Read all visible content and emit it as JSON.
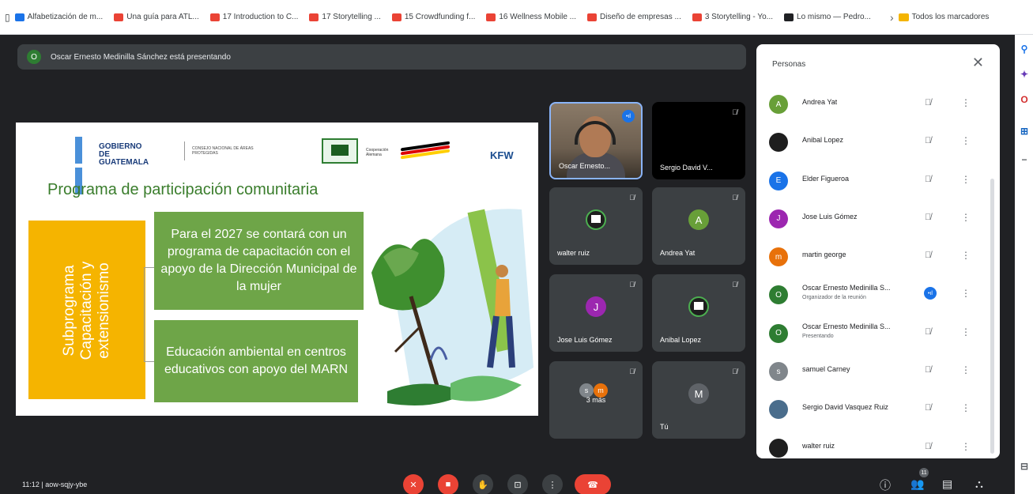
{
  "bookmarks": [
    {
      "label": "Alfabetización de m...",
      "color": "#1a73e8"
    },
    {
      "label": "Una guía para ATL...",
      "color": "#ea4335"
    },
    {
      "label": "17 Introduction to C...",
      "color": "#ea4335"
    },
    {
      "label": "17 Storytelling ...",
      "color": "#ea4335"
    },
    {
      "label": "15 Crowdfunding f...",
      "color": "#ea4335"
    },
    {
      "label": "16 Wellness Mobile ...",
      "color": "#ea4335"
    },
    {
      "label": "Diseño de empresas ...",
      "color": "#ea4335"
    },
    {
      "label": "3 Storytelling - Yo...",
      "color": "#ea4335"
    },
    {
      "label": "Lo mismo — Pedro...",
      "color": "#202124"
    }
  ],
  "bookmarks_more": "›",
  "bookmarks_folder": "Todos los marcadores",
  "presenter_banner": {
    "avatar": "O",
    "text": "Oscar Ernesto Medinilla Sánchez está presentando"
  },
  "slide": {
    "gov_name": "GOBIERNO DE GUATEMALA",
    "gov_sub": "CONSEJO NACIONAL DE ÁREAS PROTEGIDAS",
    "coop_label": "Cooperación Alemana",
    "kfw": "KFW",
    "title": "Programa de participación comunitaria",
    "vertical_text": "Subprograma\nCapacitación y\nextensionismo",
    "box1": "Para el 2027 se contará con un programa de capacitación con el apoyo de la Dirección Municipal de la mujer",
    "box2": "Educación ambiental en centros educativos con apoyo del MARN"
  },
  "tiles": [
    {
      "name": "Oscar Ernesto...",
      "kind": "video"
    },
    {
      "name": "Sergio David V...",
      "kind": "blank"
    },
    {
      "name": "walter ruiz",
      "kind": "qr"
    },
    {
      "name": "Andrea Yat",
      "kind": "avatar",
      "initial": "A",
      "color": "#689f38"
    },
    {
      "name": "Jose Luis Gómez",
      "kind": "avatar",
      "initial": "J",
      "color": "#9c27b0"
    },
    {
      "name": "Anibal Lopez",
      "kind": "qr"
    },
    {
      "name": "3 más",
      "kind": "more",
      "initials": [
        "s",
        "m"
      ]
    },
    {
      "name": "Tú",
      "kind": "avatar",
      "initial": "M",
      "color": "#5f6368"
    }
  ],
  "panel": {
    "title": "Personas",
    "people": [
      {
        "name": "Andrea Yat",
        "initial": "A",
        "color": "#689f38"
      },
      {
        "name": "Anibal Lopez",
        "initial": "",
        "color": "#1e1e1e"
      },
      {
        "name": "Elder Figueroa",
        "initial": "E",
        "color": "#1a73e8"
      },
      {
        "name": "Jose Luis Gómez",
        "initial": "J",
        "color": "#9c27b0"
      },
      {
        "name": "martin george",
        "initial": "m",
        "color": "#e8710a"
      },
      {
        "name": "Oscar Ernesto Medinilla S...",
        "role": "Organizador de la reunión",
        "initial": "O",
        "color": "#2e7d32"
      },
      {
        "name": "Oscar Ernesto Medinilla S...",
        "role": "Presentando",
        "initial": "O",
        "color": "#2e7d32"
      },
      {
        "name": "samuel Carney",
        "initial": "s",
        "color": "#80868b"
      },
      {
        "name": "Sergio David Vasquez Ruiz",
        "initial": "",
        "color": "#4a6d8c"
      },
      {
        "name": "walter ruiz",
        "initial": "",
        "color": "#1e1e1e"
      }
    ]
  },
  "bottom": {
    "time": "11:12",
    "meeting_code": "aow-sqjy-ybe",
    "people_count": "11"
  }
}
